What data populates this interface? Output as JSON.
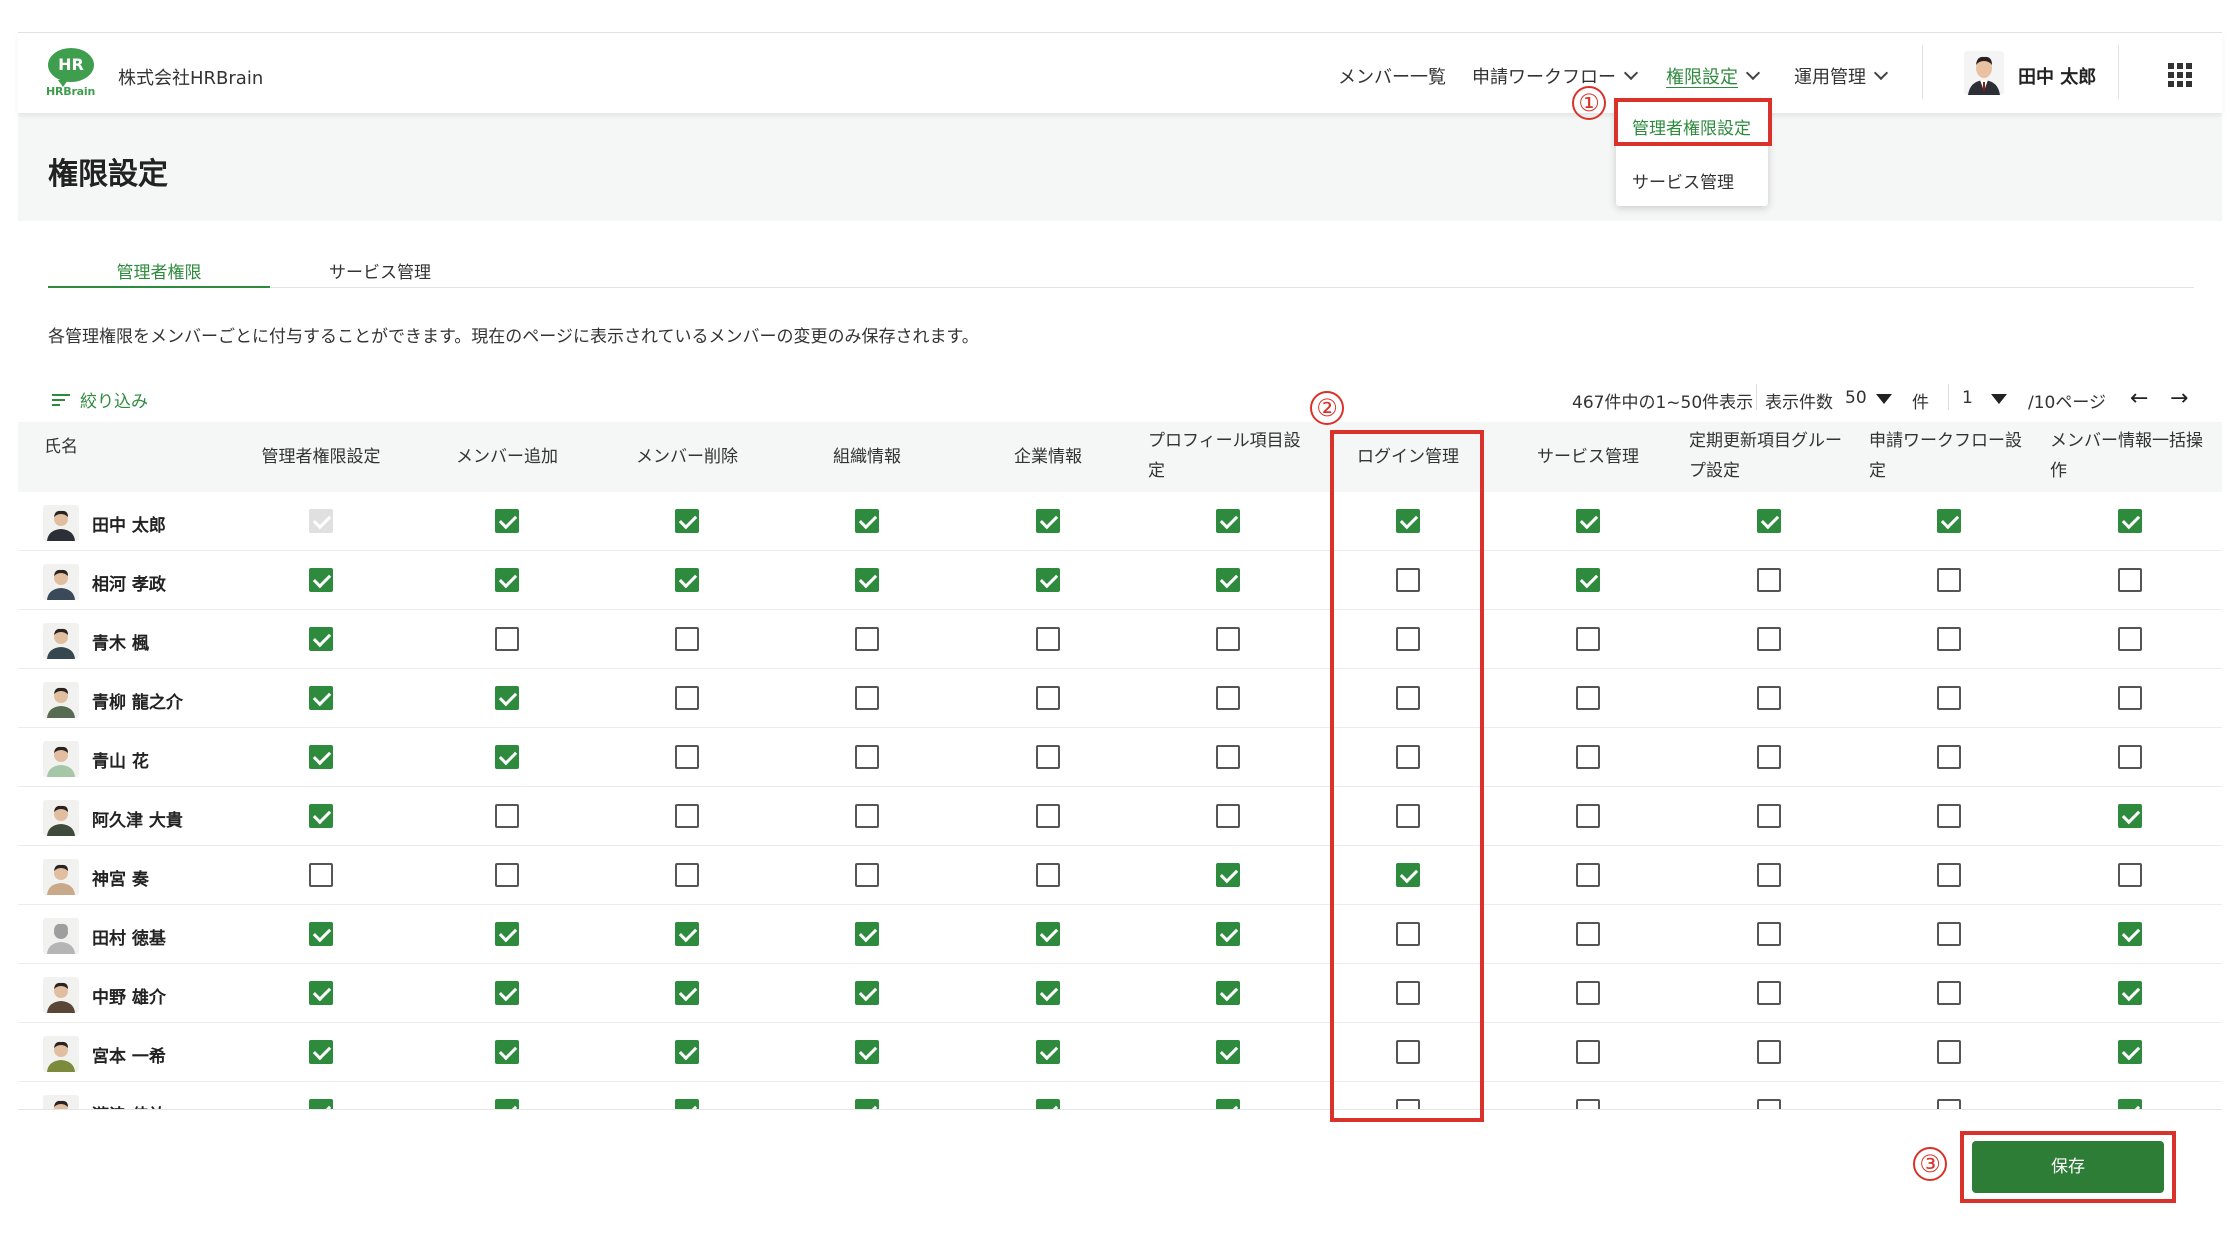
{
  "header": {
    "logo_text": "HR",
    "logo_word": "HRBrain",
    "company": "株式会社HRBrain",
    "nav": [
      "メンバー一覧",
      "申請ワークフロー",
      "権限設定",
      "運用管理"
    ],
    "user_name": "田中 太郎"
  },
  "dropdown": [
    "管理者権限設定",
    "サービス管理"
  ],
  "page_title": "権限設定",
  "tabs": [
    "管理者権限",
    "サービス管理"
  ],
  "description": "各管理権限をメンバーごとに付与することができます。現在のページに表示されているメンバーの変更のみ保存されます。",
  "filter_label": "絞り込み",
  "pagination": {
    "summary": "467件中の1~50件表示",
    "per_page_label": "表示件数",
    "per_page": "50",
    "unit": "件",
    "page": "1",
    "total_pages": "/10ページ",
    "prev": "←",
    "next": "→"
  },
  "table": {
    "name_header": "氏名",
    "columns": [
      {
        "line1": "管理者権限設定",
        "line2": ""
      },
      {
        "line1": "メンバー追加",
        "line2": ""
      },
      {
        "line1": "メンバー削除",
        "line2": ""
      },
      {
        "line1": "組織情報",
        "line2": ""
      },
      {
        "line1": "企業情報",
        "line2": ""
      },
      {
        "line1": "プロフィール項目設",
        "line2": "定"
      },
      {
        "line1": "ログイン管理",
        "line2": ""
      },
      {
        "line1": "サービス管理",
        "line2": ""
      },
      {
        "line1": "定期更新項目グルー",
        "line2": "プ設定"
      },
      {
        "line1": "申請ワークフロー設",
        "line2": "定"
      },
      {
        "line1": "メンバー情報一括操",
        "line2": "作"
      }
    ],
    "rows": [
      {
        "name": "田中 太郎",
        "checks": [
          2,
          1,
          1,
          1,
          1,
          1,
          1,
          1,
          1,
          1,
          1
        ]
      },
      {
        "name": "相河 孝政",
        "checks": [
          1,
          1,
          1,
          1,
          1,
          1,
          0,
          1,
          0,
          0,
          0
        ]
      },
      {
        "name": "青木 楓",
        "checks": [
          1,
          0,
          0,
          0,
          0,
          0,
          0,
          0,
          0,
          0,
          0
        ]
      },
      {
        "name": "青柳 龍之介",
        "checks": [
          1,
          1,
          0,
          0,
          0,
          0,
          0,
          0,
          0,
          0,
          0
        ]
      },
      {
        "name": "青山 花",
        "checks": [
          1,
          1,
          0,
          0,
          0,
          0,
          0,
          0,
          0,
          0,
          0
        ]
      },
      {
        "name": "阿久津 大貴",
        "checks": [
          1,
          0,
          0,
          0,
          0,
          0,
          0,
          0,
          0,
          0,
          1
        ]
      },
      {
        "name": "神宮 奏",
        "checks": [
          0,
          0,
          0,
          0,
          0,
          1,
          1,
          0,
          0,
          0,
          0
        ]
      },
      {
        "name": "田村 徳基",
        "checks": [
          1,
          1,
          1,
          1,
          1,
          1,
          0,
          0,
          0,
          0,
          1
        ]
      },
      {
        "name": "中野 雄介",
        "checks": [
          1,
          1,
          1,
          1,
          1,
          1,
          0,
          0,
          0,
          0,
          1
        ]
      },
      {
        "name": "宮本 一希",
        "checks": [
          1,
          1,
          1,
          1,
          1,
          1,
          0,
          0,
          0,
          0,
          1
        ]
      },
      {
        "name": "瀧津 佳祐",
        "checks": [
          1,
          1,
          1,
          1,
          1,
          1,
          0,
          0,
          0,
          0,
          1
        ]
      }
    ]
  },
  "annotations": [
    "①",
    "②",
    "③"
  ],
  "save_label": "保存",
  "colors": {
    "brand_green": "#2e8b3e",
    "annotation_red": "#d9322b"
  }
}
